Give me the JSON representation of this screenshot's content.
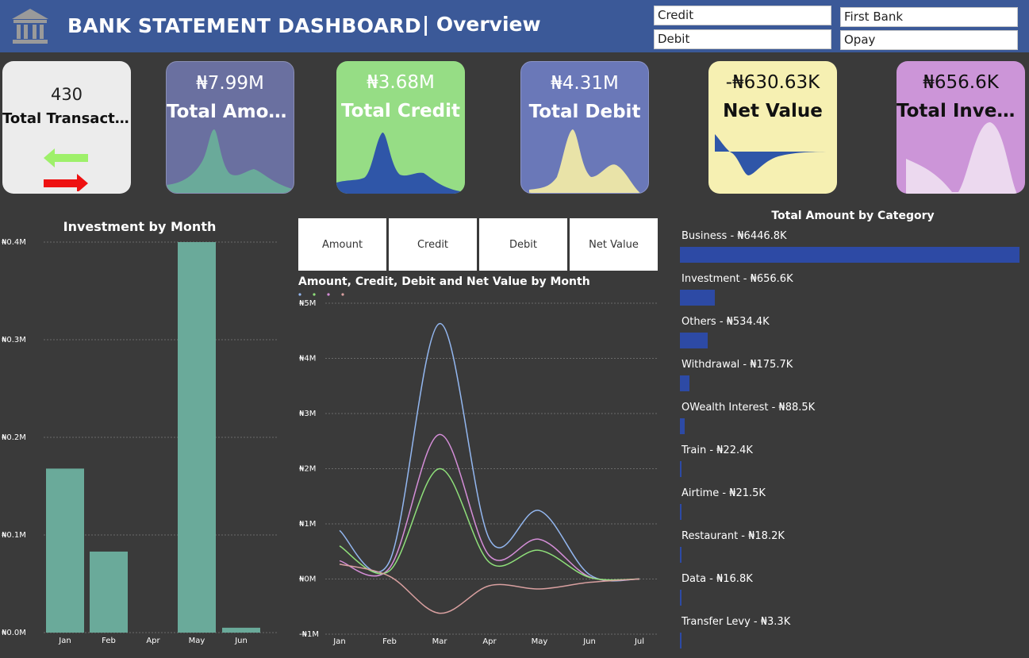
{
  "header": {
    "title": "BANK STATEMENT DASHBOARD",
    "subtitle": "| Overview",
    "slicers": {
      "type": [
        "Credit",
        "Debit"
      ],
      "bank": [
        "First Bank",
        "Opay"
      ]
    }
  },
  "kpis": {
    "transactions": {
      "value": "430",
      "label": "Total Transactions"
    },
    "amount": {
      "value": "₦7.99M",
      "label": "Total Amount"
    },
    "credit": {
      "value": "₦3.68M",
      "label": "Total Credit"
    },
    "debit": {
      "value": "₦4.31M",
      "label": "Total Debit"
    },
    "net": {
      "value": "-₦630.63K",
      "label": "Net Value"
    },
    "investment": {
      "value": "₦656.6K",
      "label": "Total Invest..."
    }
  },
  "colors": {
    "header": "#3b5998",
    "card_amount": "#6a70a0",
    "card_credit": "#96dd85",
    "card_debit": "#6a78b8",
    "card_net": "#f6f0b2",
    "card_investment": "#cc95d8",
    "teal": "#6aaa9a",
    "bar_blue": "#2d4aa5",
    "line_amount": "#93b7f0",
    "line_credit": "#8fe07a",
    "line_debit": "#d58ed8",
    "line_net": "#d9a0a0"
  },
  "metric_buttons": [
    "Amount",
    "Credit",
    "Debit",
    "Net Value"
  ],
  "category": {
    "title": "Total Amount by Category",
    "items": [
      {
        "label": "Business - ₦6446.8K",
        "value": 6446.8
      },
      {
        "label": "Investment - ₦656.6K",
        "value": 656.6
      },
      {
        "label": "Others - ₦534.4K",
        "value": 534.4
      },
      {
        "label": "Withdrawal - ₦175.7K",
        "value": 175.7
      },
      {
        "label": "OWealth Interest - ₦88.5K",
        "value": 88.5
      },
      {
        "label": "Train - ₦22.4K",
        "value": 22.4
      },
      {
        "label": "Airtime - ₦21.5K",
        "value": 21.5
      },
      {
        "label": "Restaurant - ₦18.2K",
        "value": 18.2
      },
      {
        "label": "Data - ₦16.8K",
        "value": 16.8
      },
      {
        "label": "Transfer Levy - ₦3.3K",
        "value": 3.3
      }
    ]
  },
  "chart_data": [
    {
      "type": "bar",
      "title": "Investment by Month",
      "categories": [
        "Jan",
        "Feb",
        "Apr",
        "May",
        "Jun"
      ],
      "values": [
        0.168,
        0.083,
        0.0,
        0.4,
        0.005
      ],
      "y_ticks": [
        "₦0.0M",
        "₦0.1M",
        "₦0.2M",
        "₦0.3M",
        "₦0.4M"
      ],
      "ylim": [
        0,
        0.4
      ],
      "grid": true
    },
    {
      "type": "line",
      "title": "Amount, Credit, Debit and Net Value by Month",
      "categories": [
        "Jan",
        "Feb",
        "Mar",
        "Apr",
        "May",
        "Jun",
        "Jul"
      ],
      "series": [
        {
          "key": "amount",
          "values": [
            0.88,
            0.32,
            4.63,
            0.72,
            1.24,
            0.08,
            0.0
          ]
        },
        {
          "key": "debit",
          "values": [
            0.33,
            0.2,
            2.62,
            0.42,
            0.72,
            0.04,
            0.0
          ]
        },
        {
          "key": "credit",
          "values": [
            0.6,
            0.15,
            2.0,
            0.3,
            0.52,
            0.03,
            0.0
          ]
        },
        {
          "key": "net",
          "values": [
            0.27,
            0.05,
            -0.62,
            -0.12,
            -0.18,
            -0.06,
            0.0
          ]
        }
      ],
      "y_ticks": [
        "-₦1M",
        "₦0M",
        "₦1M",
        "₦2M",
        "₦3M",
        "₦4M",
        "₦5M"
      ],
      "ylim": [
        -1,
        5
      ],
      "grid": true,
      "legend": "top-left"
    }
  ]
}
